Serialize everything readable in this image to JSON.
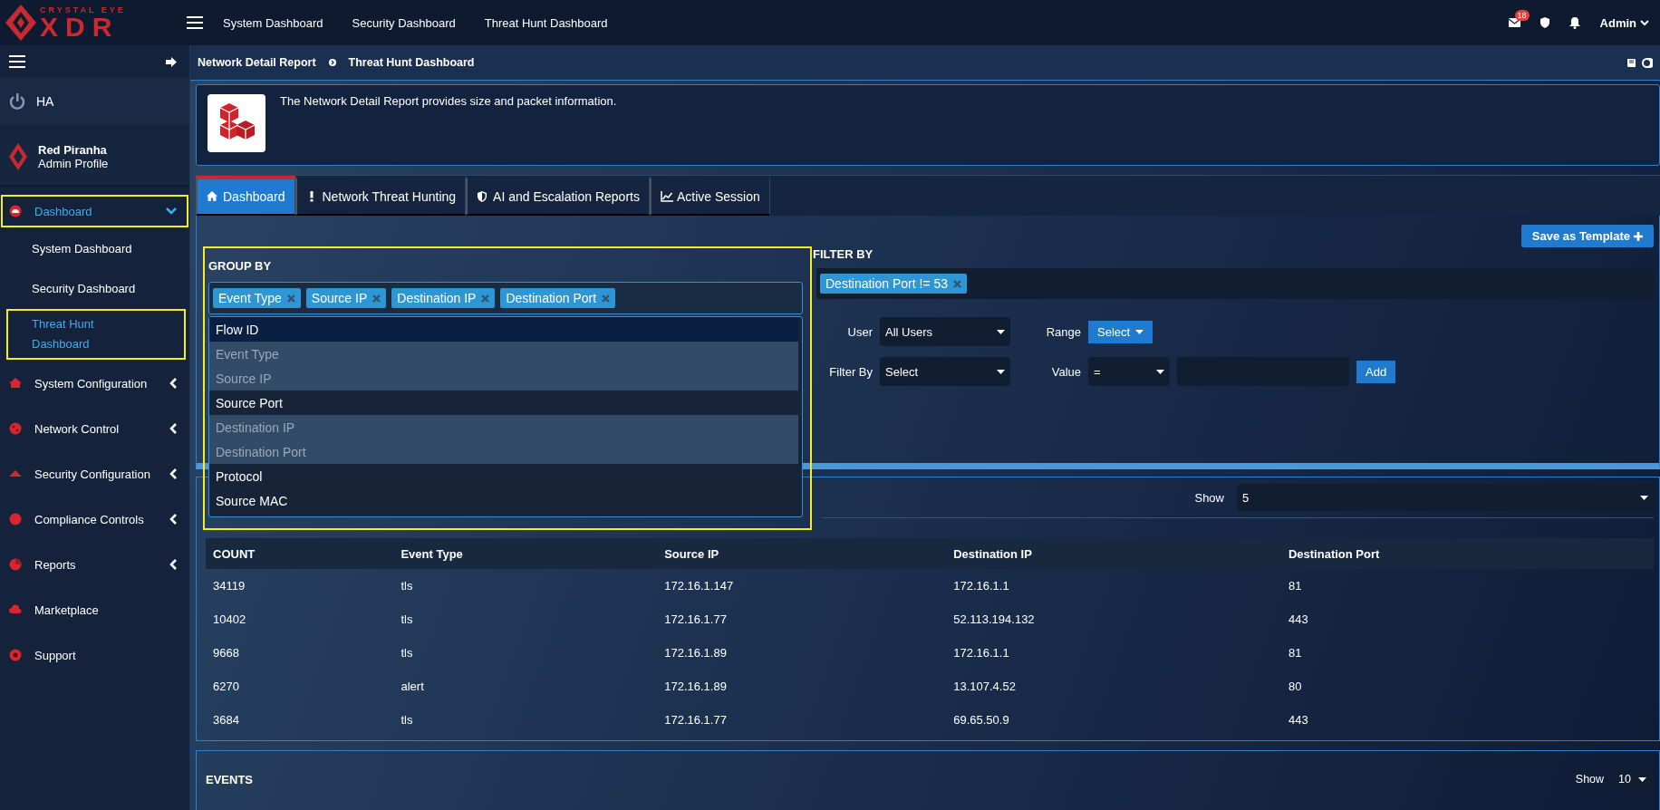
{
  "header": {
    "logo_top": "CRYSTAL EYE",
    "logo_main": "XDR",
    "nav": [
      "System Dashboard",
      "Security Dashboard",
      "Threat Hunt Dashboard"
    ],
    "mail_count": "18",
    "user": "Admin"
  },
  "sidebar": {
    "ha_label": "HA",
    "profile_name": "Red Piranha",
    "profile_role": "Admin Profile",
    "items": [
      {
        "label": "Dashboard",
        "selected": true,
        "highlighted": true,
        "expanded": true,
        "children": [
          {
            "label": "System Dashboard",
            "selected": false,
            "highlighted": false
          },
          {
            "label": "Security Dashboard",
            "selected": false,
            "highlighted": false
          },
          {
            "label": "Threat Hunt Dashboard",
            "selected": true,
            "highlighted": true
          }
        ]
      },
      {
        "label": "System Configuration",
        "selected": false,
        "highlighted": false,
        "expanded": false
      },
      {
        "label": "Network Control",
        "selected": false,
        "highlighted": false,
        "expanded": false
      },
      {
        "label": "Security Configuration",
        "selected": false,
        "highlighted": false,
        "expanded": false
      },
      {
        "label": "Compliance Controls",
        "selected": false,
        "highlighted": false,
        "expanded": false
      },
      {
        "label": "Reports",
        "selected": false,
        "highlighted": false,
        "expanded": false
      },
      {
        "label": "Marketplace",
        "selected": false,
        "highlighted": false
      },
      {
        "label": "Support",
        "selected": false,
        "highlighted": false
      }
    ]
  },
  "breadcrumb": [
    "Network Detail Report",
    "Threat Hunt Dashboard"
  ],
  "info": "The Network Detail Report provides size and packet information.",
  "tabs": [
    {
      "label": "Dashboard",
      "selected": true
    },
    {
      "label": "Network Threat Hunting",
      "selected": false
    },
    {
      "label": "AI and Escalation Reports",
      "selected": false
    },
    {
      "label": "Active Session",
      "selected": false
    }
  ],
  "save_button": "Save as Template",
  "group_by": {
    "title": "GROUP BY",
    "highlighted": true,
    "tags": [
      "Event Type",
      "Source IP",
      "Destination IP",
      "Destination Port"
    ],
    "options": [
      {
        "label": "Flow ID",
        "selected": false,
        "hovered": true
      },
      {
        "label": "Event Type",
        "selected": true,
        "hovered": false
      },
      {
        "label": "Source IP",
        "selected": true,
        "hovered": false
      },
      {
        "label": "Source Port",
        "selected": false,
        "hovered": false
      },
      {
        "label": "Destination IP",
        "selected": true,
        "hovered": false
      },
      {
        "label": "Destination Port",
        "selected": true,
        "hovered": false
      },
      {
        "label": "Protocol",
        "selected": false,
        "hovered": false
      },
      {
        "label": "Source MAC",
        "selected": false,
        "hovered": false
      }
    ]
  },
  "filter_by": {
    "title": "FILTER BY",
    "tags": [
      "Destination Port != 53"
    ],
    "user_label": "User",
    "user_value": "All Users",
    "range_label": "Range",
    "range_button": "Select",
    "filter_label": "Filter By",
    "filter_value": "Select",
    "value_label": "Value",
    "operator": "=",
    "add_button": "Add"
  },
  "table": {
    "show_label": "Show",
    "show_value": "5",
    "columns": [
      "COUNT",
      "Event Type",
      "Source IP",
      "Destination IP",
      "Destination Port"
    ],
    "rows": [
      [
        "34119",
        "tls",
        "172.16.1.147",
        "172.16.1.1",
        "81"
      ],
      [
        "10402",
        "tls",
        "172.16.1.77",
        "52.113.194.132",
        "443"
      ],
      [
        "9668",
        "tls",
        "172.16.1.89",
        "172.16.1.1",
        "81"
      ],
      [
        "6270",
        "alert",
        "172.16.1.89",
        "13.107.4.52",
        "80"
      ],
      [
        "3684",
        "tls",
        "172.16.1.77",
        "69.65.50.9",
        "443"
      ]
    ]
  },
  "events": {
    "title": "EVENTS",
    "show_label": "Show",
    "show_value": "10"
  }
}
